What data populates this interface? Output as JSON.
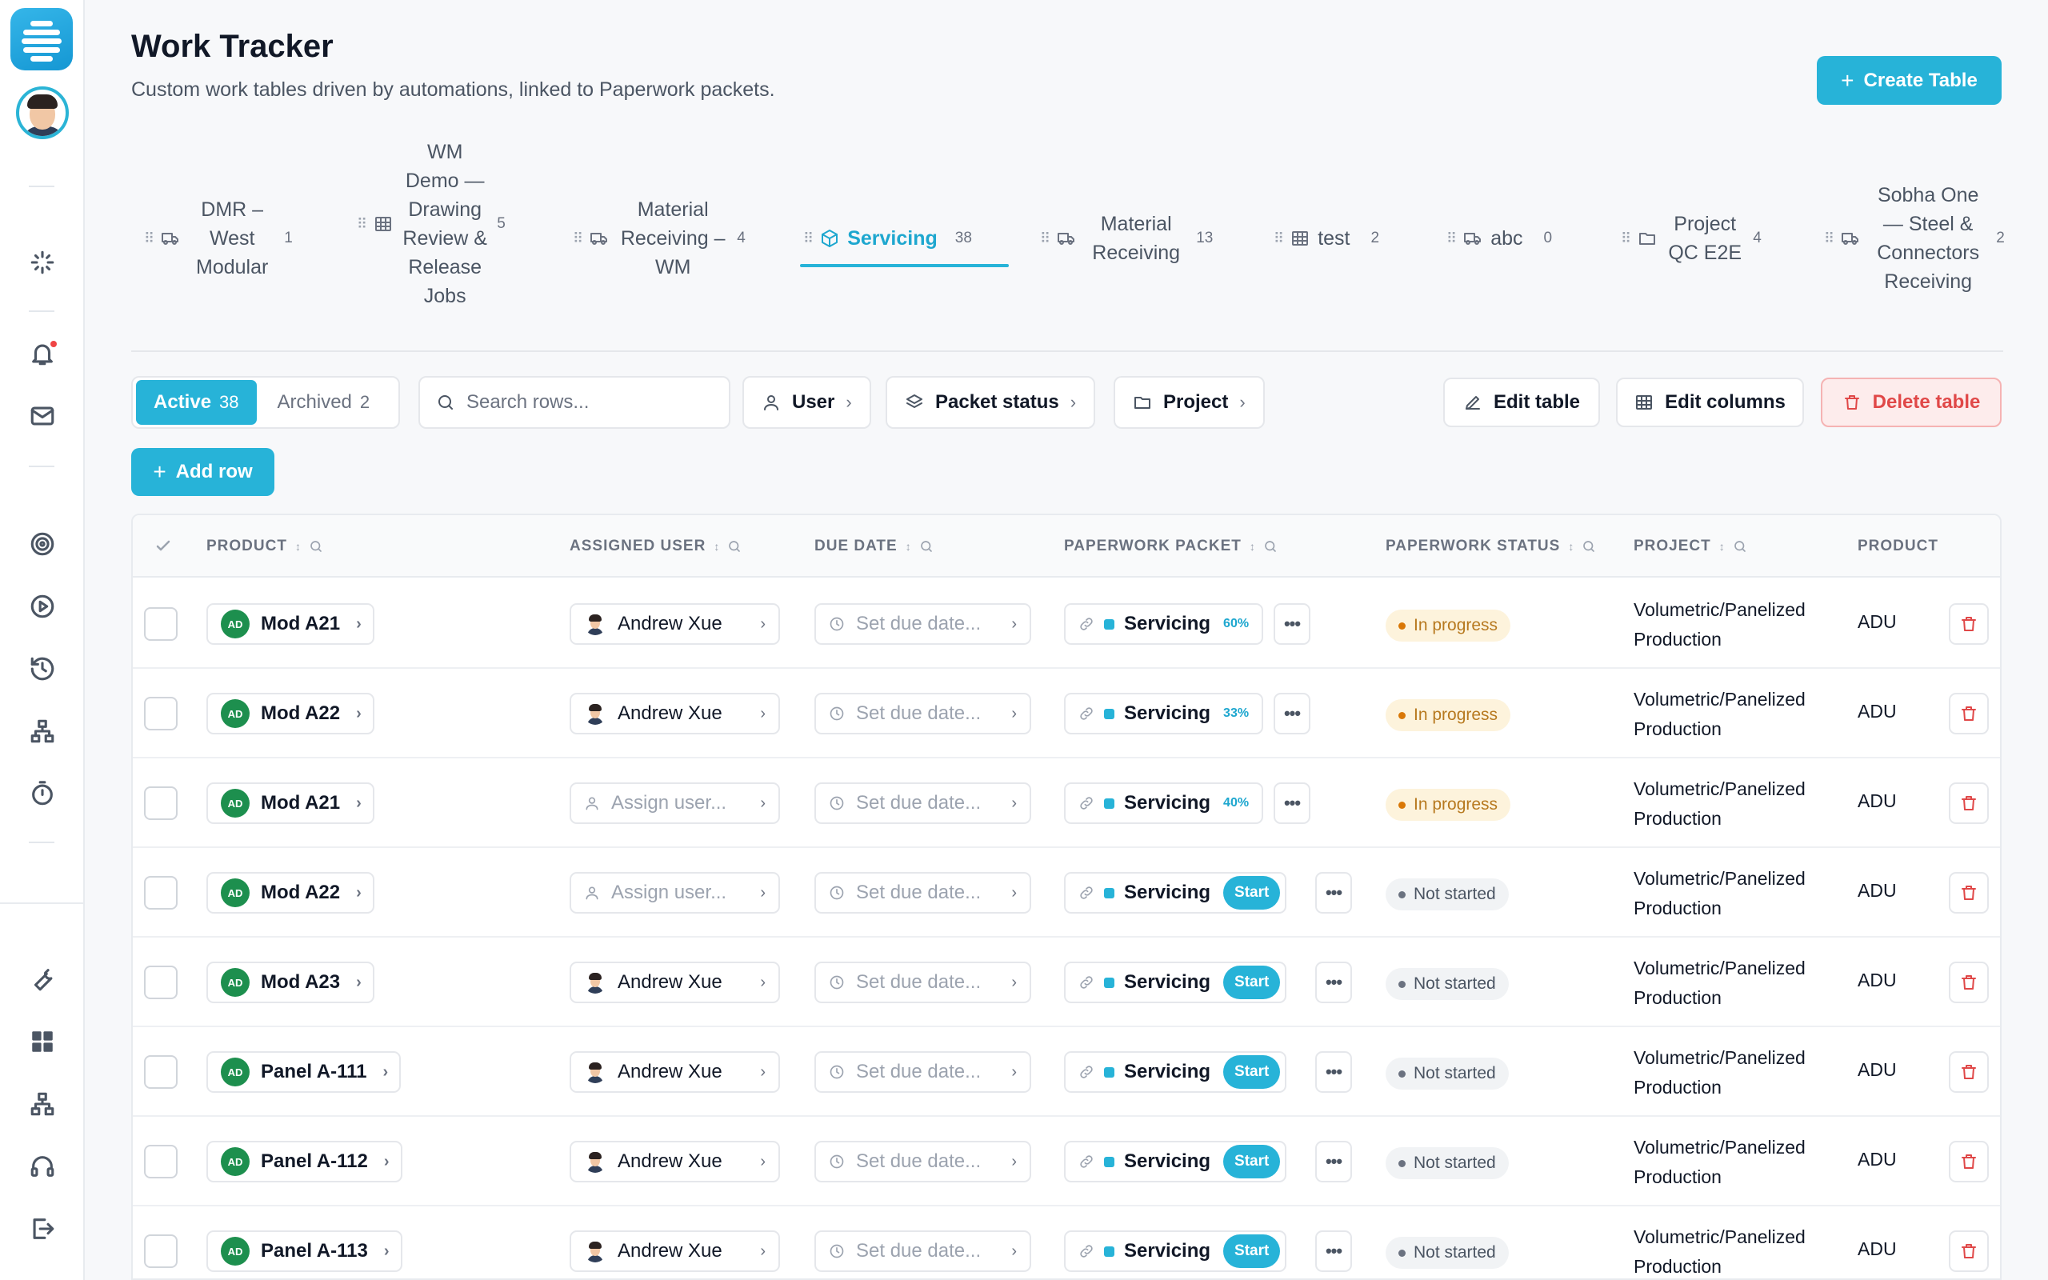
{
  "app": {
    "title": "Work Tracker",
    "subtitle": "Custom work tables driven by automations, linked to Paperwork packets.",
    "create_label": "Create Table"
  },
  "sidebar": {
    "icons": [
      "sparkles-icon",
      "bell-icon",
      "mail-icon",
      "target-icon",
      "play-circle-icon",
      "history-icon",
      "network-icon",
      "timer-icon",
      "wrench-icon",
      "grid-icon",
      "sitemap-icon",
      "headset-icon",
      "logout-icon"
    ]
  },
  "tabs": [
    {
      "label": "DMR – West Modular",
      "count": "1",
      "icon": "truck-icon"
    },
    {
      "label": "WM Demo — Drawing Review & Release Jobs",
      "count": "5",
      "icon": "table-icon"
    },
    {
      "label": "Material Receiving – WM",
      "count": "4",
      "icon": "truck-icon"
    },
    {
      "label": "Servicing",
      "count": "38",
      "icon": "package-icon",
      "active": true
    },
    {
      "label": "Material Receiving",
      "count": "13",
      "icon": "truck-icon"
    },
    {
      "label": "test",
      "count": "2",
      "icon": "table-icon"
    },
    {
      "label": "abc",
      "count": "0",
      "icon": "truck-icon"
    },
    {
      "label": "Project QC E2E",
      "count": "4",
      "icon": "folder-icon"
    },
    {
      "label": "Sobha One — Steel & Connectors Receiving",
      "count": "2",
      "icon": "truck-icon"
    }
  ],
  "toolbar": {
    "active_label": "Active",
    "active_count": "38",
    "archived_label": "Archived",
    "archived_count": "2",
    "search_placeholder": "Search rows...",
    "filter_user": "User",
    "filter_packet_status": "Packet status",
    "filter_project": "Project",
    "edit_table": "Edit table",
    "edit_columns": "Edit columns",
    "delete_table": "Delete table",
    "add_row": "Add row"
  },
  "table": {
    "columns": [
      "PRODUCT",
      "ASSIGNED USER",
      "DUE DATE",
      "PAPERWORK PACKET",
      "PAPERWORK STATUS",
      "PROJECT",
      "PRODUCT"
    ],
    "due_placeholder": "Set due date...",
    "assign_placeholder": "Assign user...",
    "start_label": "Start",
    "rows": [
      {
        "initials": "AD",
        "product": "Mod A21",
        "user": "Andrew Xue",
        "packet": "Servicing",
        "progress": "60%",
        "status": "In progress",
        "project": "Volumetric/Panelized Production",
        "product_type": "ADU"
      },
      {
        "initials": "AD",
        "product": "Mod A22",
        "user": "Andrew Xue",
        "packet": "Servicing",
        "progress": "33%",
        "status": "In progress",
        "project": "Volumetric/Panelized Production",
        "product_type": "ADU"
      },
      {
        "initials": "AD",
        "product": "Mod A21",
        "user": "",
        "packet": "Servicing",
        "progress": "40%",
        "status": "In progress",
        "project": "Volumetric/Panelized Production",
        "product_type": "ADU"
      },
      {
        "initials": "AD",
        "product": "Mod A22",
        "user": "",
        "packet": "Servicing",
        "progress": "",
        "status": "Not started",
        "project": "Volumetric/Panelized Production",
        "product_type": "ADU"
      },
      {
        "initials": "AD",
        "product": "Mod A23",
        "user": "Andrew Xue",
        "packet": "Servicing",
        "progress": "",
        "status": "Not started",
        "project": "Volumetric/Panelized Production",
        "product_type": "ADU"
      },
      {
        "initials": "AD",
        "product": "Panel A-111",
        "user": "Andrew Xue",
        "packet": "Servicing",
        "progress": "",
        "status": "Not started",
        "project": "Volumetric/Panelized Production",
        "product_type": "ADU"
      },
      {
        "initials": "AD",
        "product": "Panel A-112",
        "user": "Andrew Xue",
        "packet": "Servicing",
        "progress": "",
        "status": "Not started",
        "project": "Volumetric/Panelized Production",
        "product_type": "ADU"
      },
      {
        "initials": "AD",
        "product": "Panel A-113",
        "user": "Andrew Xue",
        "packet": "Servicing",
        "progress": "",
        "status": "Not started",
        "project": "Volumetric/Panelized Production",
        "product_type": "ADU"
      }
    ]
  },
  "colors": {
    "accent": "#27b3d8",
    "badge_green": "#1d8f4e",
    "danger": "#e04848",
    "in_progress": "#b7791f"
  }
}
